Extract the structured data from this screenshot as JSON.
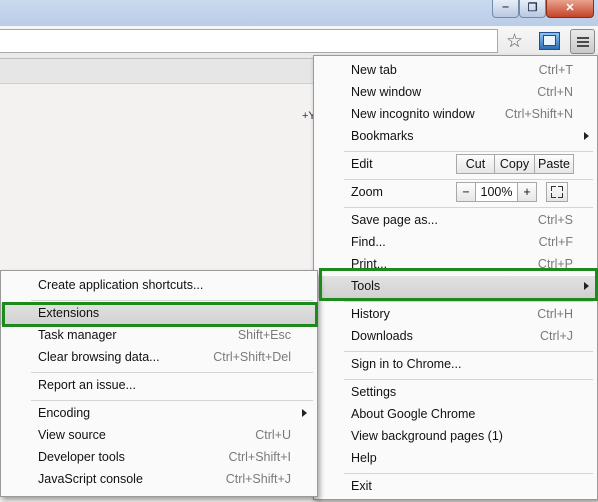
{
  "window": {
    "minimize_glyph": "‒",
    "maximize_glyph": "❐",
    "close_glyph": "✕"
  },
  "toolbar": {
    "bookmark_icon": "star-icon",
    "extension_icon": "page-icon",
    "menu_icon": "hamburger-menu-icon"
  },
  "page": {
    "text_fragment": "+Y"
  },
  "main_menu": {
    "new_tab": {
      "label": "New tab",
      "shortcut": "Ctrl+T"
    },
    "new_window": {
      "label": "New window",
      "shortcut": "Ctrl+N"
    },
    "new_incognito": {
      "label": "New incognito window",
      "shortcut": "Ctrl+Shift+N"
    },
    "bookmarks": {
      "label": "Bookmarks"
    },
    "edit": {
      "label": "Edit",
      "cut": "Cut",
      "copy": "Copy",
      "paste": "Paste"
    },
    "zoom": {
      "label": "Zoom",
      "minus": "−",
      "value": "100%",
      "plus": "+"
    },
    "save_page": {
      "label": "Save page as...",
      "shortcut": "Ctrl+S"
    },
    "find": {
      "label": "Find...",
      "shortcut": "Ctrl+F"
    },
    "print": {
      "label": "Print...",
      "shortcut": "Ctrl+P"
    },
    "tools": {
      "label": "Tools"
    },
    "history": {
      "label": "History",
      "shortcut": "Ctrl+H"
    },
    "downloads": {
      "label": "Downloads",
      "shortcut": "Ctrl+J"
    },
    "sign_in": {
      "label": "Sign in to Chrome..."
    },
    "settings": {
      "label": "Settings"
    },
    "about": {
      "label": "About Google Chrome"
    },
    "background_pages": {
      "label": "View background pages (1)"
    },
    "help": {
      "label": "Help"
    },
    "exit": {
      "label": "Exit"
    }
  },
  "tools_menu": {
    "create_shortcuts": {
      "label": "Create application shortcuts..."
    },
    "extensions": {
      "label": "Extensions"
    },
    "task_manager": {
      "label": "Task manager",
      "shortcut": "Shift+Esc"
    },
    "clear_data": {
      "label": "Clear browsing data...",
      "shortcut": "Ctrl+Shift+Del"
    },
    "report_issue": {
      "label": "Report an issue..."
    },
    "encoding": {
      "label": "Encoding"
    },
    "view_source": {
      "label": "View source",
      "shortcut": "Ctrl+U"
    },
    "dev_tools": {
      "label": "Developer tools",
      "shortcut": "Ctrl+Shift+I"
    },
    "js_console": {
      "label": "JavaScript console",
      "shortcut": "Ctrl+Shift+J"
    }
  },
  "highlight_color": "#1e8a1e"
}
